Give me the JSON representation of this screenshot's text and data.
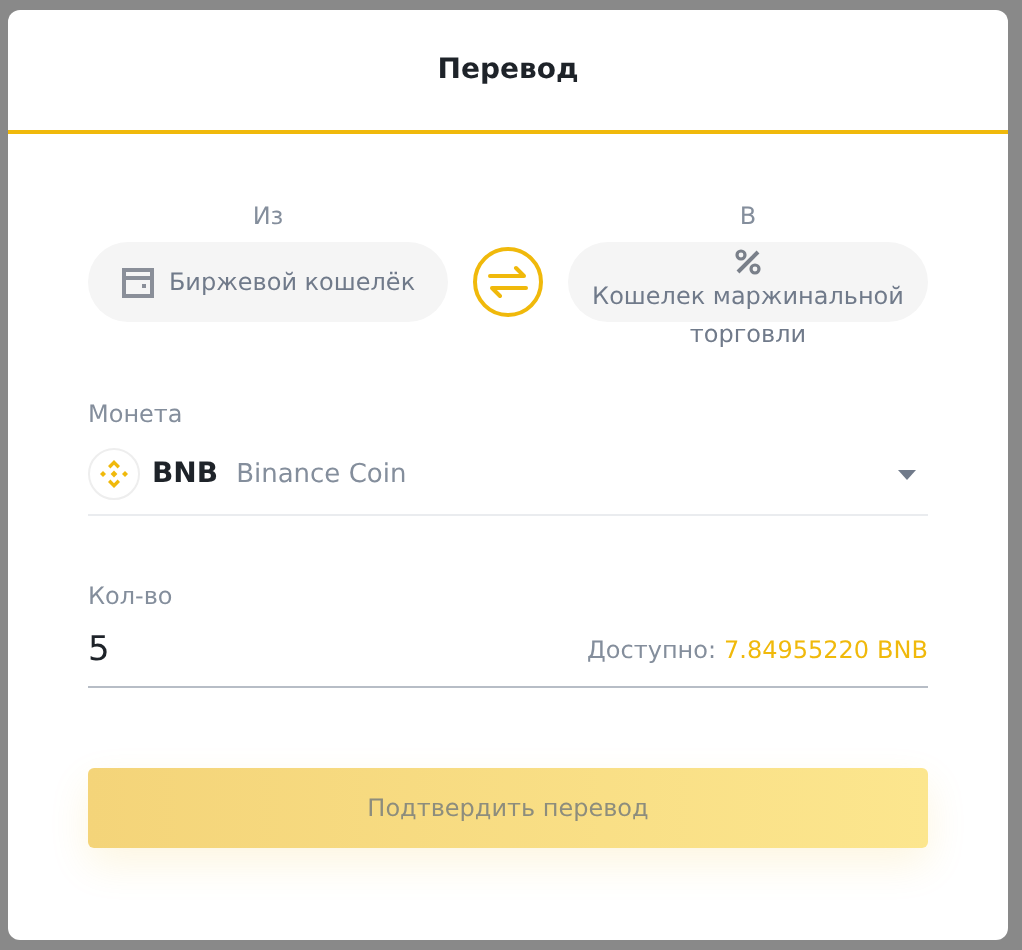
{
  "dialog": {
    "title": "Перевод"
  },
  "from": {
    "label": "Из",
    "wallet": "Биржевой кошелёк"
  },
  "to": {
    "label": "В",
    "wallet": "Кошелек маржинальной торговли"
  },
  "coin": {
    "label": "Монета",
    "symbol": "BNB",
    "name": "Binance Coin"
  },
  "amount": {
    "label": "Кол-во",
    "value": "5",
    "available_label": "Доступно:",
    "available_value": "7.84955220",
    "available_unit": "BNB"
  },
  "confirm_button": "Подтвердить перевод"
}
